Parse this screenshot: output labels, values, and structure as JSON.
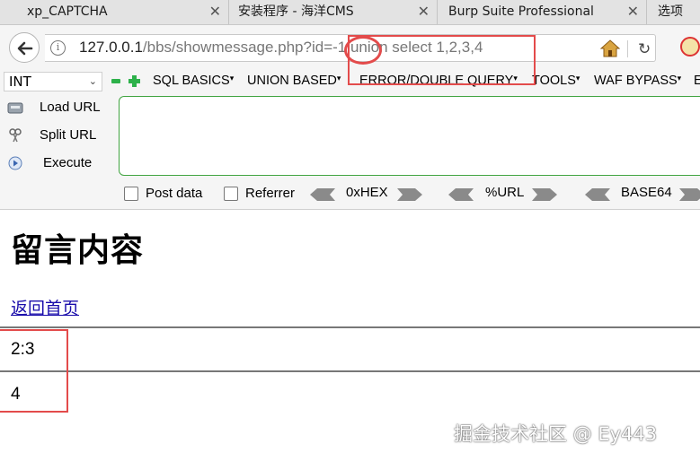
{
  "tabs": [
    {
      "title": "xp_CAPTCHA",
      "active": false
    },
    {
      "title": "安装程序 - 海洋CMS",
      "active": false
    },
    {
      "title": "Burp Suite Professional",
      "active": false
    },
    {
      "title": "选项",
      "active": false
    }
  ],
  "tab_close_glyph": "✕",
  "url": {
    "host": "127.0.0.1",
    "path": "/bbs/showmessage.php?id=-1 union select 1,2,3,4"
  },
  "hackbar": {
    "type_select": "INT",
    "menus": [
      "SQL BASICS",
      "UNION BASED",
      "ERROR/DOUBLE QUERY",
      "TOOLS",
      "WAF BYPASS",
      "E"
    ],
    "buttons": {
      "load_url": "Load URL",
      "split_url": "Split URL",
      "execute": "Execute"
    },
    "post_data_label": "Post data",
    "referrer_label": "Referrer",
    "encoders": [
      "0xHEX",
      "%URL",
      "BASE64"
    ],
    "textarea_value": ""
  },
  "page": {
    "title": "留言内容",
    "back_link": "返回首页",
    "messages": [
      "2:3",
      "4"
    ]
  },
  "watermark": "掘金技术社区 @ Ey443",
  "colors": {
    "annotation_red": "#e34b4b",
    "hackbar_green": "#41a441",
    "link_blue": "#1a0dab"
  },
  "icons": [
    "back-arrow-icon",
    "info-icon",
    "home-icon",
    "reload-icon",
    "noscript-icon",
    "minus-icon",
    "plus-icon",
    "load-url-icon",
    "split-url-icon",
    "execute-icon"
  ]
}
